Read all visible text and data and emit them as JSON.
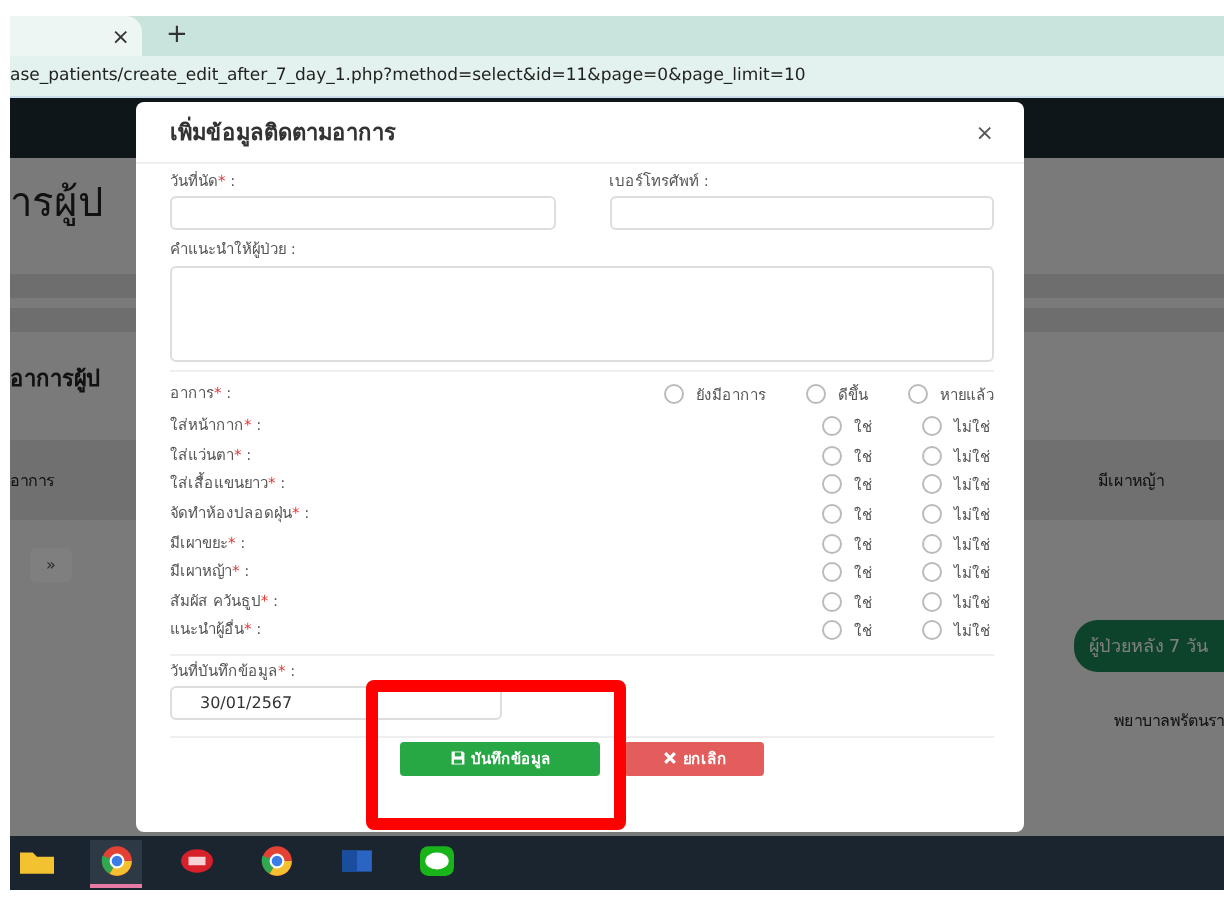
{
  "browser": {
    "tab_close": "×",
    "new_tab": "+",
    "url": "ase_patients/create_edit_after_7_day_1.php?method=select&id=11&page=0&page_limit=10"
  },
  "background": {
    "heading": "ารผู้ป",
    "section_title": "อาการผู้ป",
    "column_1": "อาการ",
    "column_2": "มีเผาหญ้า",
    "pager": "»",
    "action_button": "ผู้ป่วยหลัง 7 วัน",
    "footer_text": "พยาบาลพรัตนรา"
  },
  "modal": {
    "title": "เพิ่มข้อมูลติดตามอาการ",
    "close": "×",
    "date_field": {
      "label": "วันที่นัด",
      "star": "*",
      "colon": ":"
    },
    "phone_field": {
      "label": "เบอร์โทรศัพท์",
      "colon": ":"
    },
    "advice_field": {
      "label": "คำแนะนำให้ผู้ป่วย",
      "colon": ":"
    },
    "symptom": {
      "label": "อาการ",
      "star": "*",
      "colon": ":",
      "options": [
        {
          "label": "ยังมีอาการ",
          "selected": false
        },
        {
          "label": "ดีขึ้น",
          "selected": false
        },
        {
          "label": "หายแล้ว",
          "selected": false
        }
      ]
    },
    "questions": [
      {
        "label": "ใส่หน้ากาก",
        "star": "*",
        "colon": ":",
        "options": [
          {
            "label": "ใช่",
            "selected": false
          },
          {
            "label": "ไม่ใช่",
            "selected": false
          }
        ]
      },
      {
        "label": "ใส่แว่นตา",
        "star": "*",
        "colon": ":",
        "options": [
          {
            "label": "ใช่",
            "selected": false
          },
          {
            "label": "ไม่ใช่",
            "selected": false
          }
        ]
      },
      {
        "label": "ใส่เสื้อแขนยาว",
        "star": "*",
        "colon": ":",
        "options": [
          {
            "label": "ใช่",
            "selected": false
          },
          {
            "label": "ไม่ใช่",
            "selected": false
          }
        ]
      },
      {
        "label": "จัดทำห้องปลอดฝุ่น",
        "star": "*",
        "colon": ":",
        "options": [
          {
            "label": "ใช่",
            "selected": false
          },
          {
            "label": "ไม่ใช่",
            "selected": false
          }
        ]
      },
      {
        "label": "มีเผาขยะ",
        "star": "*",
        "colon": ":",
        "options": [
          {
            "label": "ใช่",
            "selected": false
          },
          {
            "label": "ไม่ใช่",
            "selected": false
          }
        ]
      },
      {
        "label": "มีเผาหญ้า",
        "star": "*",
        "colon": ":",
        "options": [
          {
            "label": "ใช่",
            "selected": false
          },
          {
            "label": "ไม่ใช่",
            "selected": false
          }
        ]
      },
      {
        "label": "สัมผัส ควันธูป",
        "star": "*",
        "colon": ":",
        "options": [
          {
            "label": "ใช่",
            "selected": false
          },
          {
            "label": "ไม่ใช่",
            "selected": false
          }
        ]
      },
      {
        "label": "แนะนำผู้อื่น",
        "star": "*",
        "colon": ":",
        "options": [
          {
            "label": "ใช่",
            "selected": false
          },
          {
            "label": "ไม่ใช่",
            "selected": false
          }
        ]
      }
    ],
    "record_date": {
      "label": "วันที่บันทึกข้อมูล",
      "star": "*",
      "colon": ":",
      "value": "30/01/2567"
    },
    "buttons": [
      {
        "kind": "save",
        "label": "บันทึกข้อมูล",
        "highlighted": true
      },
      {
        "kind": "cancel",
        "label": "ยกเลิก",
        "highlighted": false
      }
    ]
  },
  "taskbar": [
    {
      "kind": "folder",
      "active": false
    },
    {
      "kind": "browser",
      "active": true
    },
    {
      "kind": "app",
      "active": false
    },
    {
      "kind": "browser",
      "active": false
    },
    {
      "kind": "document",
      "active": false
    },
    {
      "kind": "chat",
      "active": false
    }
  ]
}
